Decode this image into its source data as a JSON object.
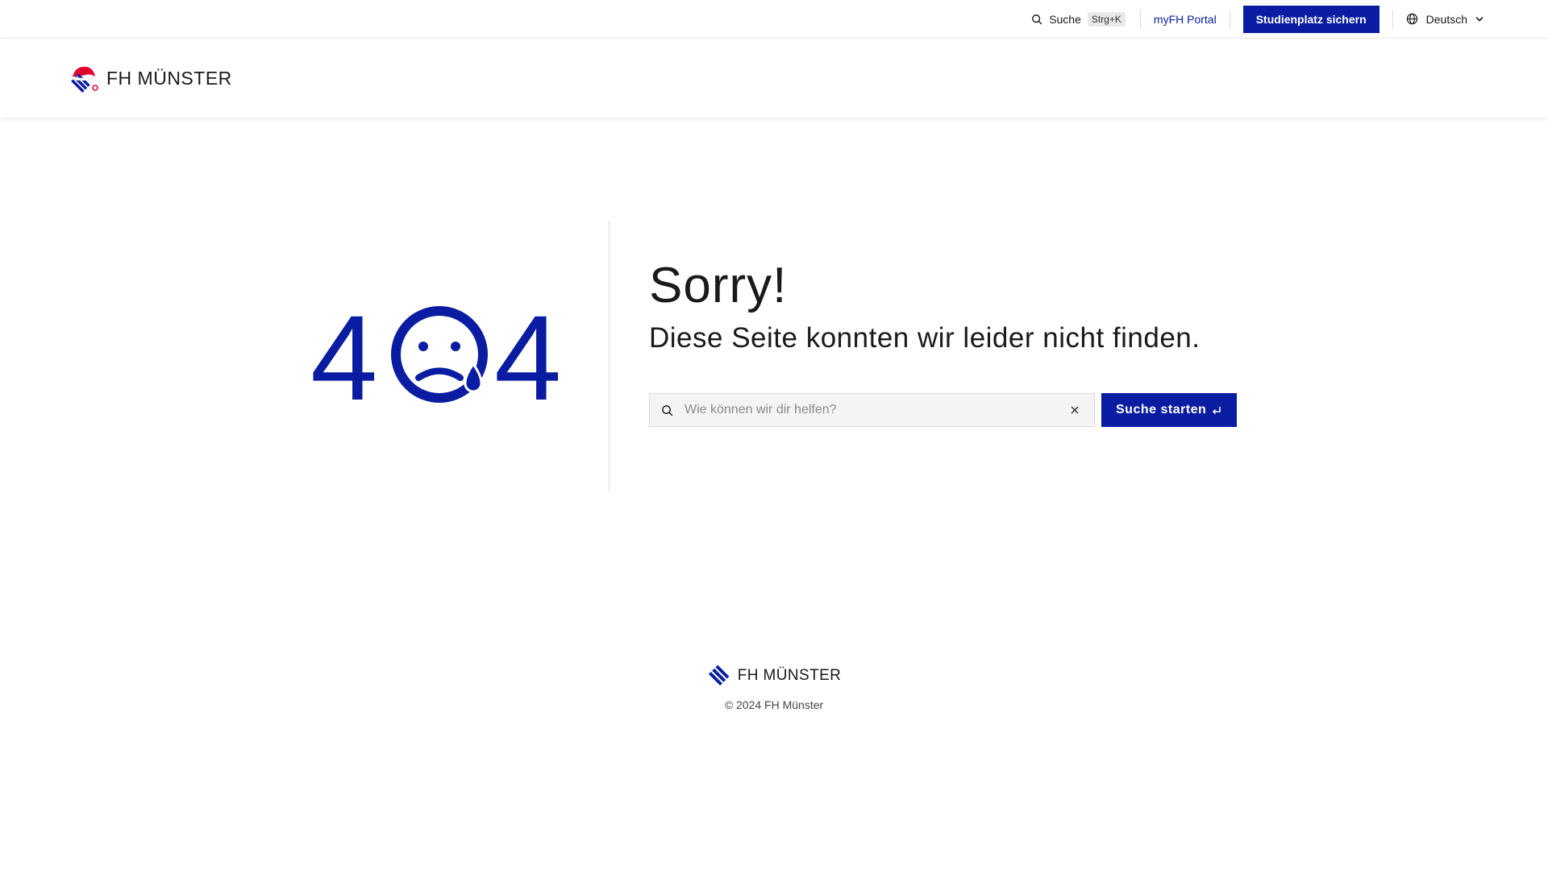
{
  "utility": {
    "search_label": "Suche",
    "search_shortcut": "Strg+K",
    "portal_link": "myFH Portal",
    "cta_label": "Studienplatz sichern",
    "language": "Deutsch"
  },
  "header": {
    "logo_text": "FH MÜNSTER"
  },
  "error": {
    "code_left": "4",
    "code_right": "4",
    "title": "Sorry!",
    "subtitle": "Diese Seite konnten wir leider nicht finden.",
    "search_placeholder": "Wie können wir dir helfen?",
    "search_value": "",
    "search_button": "Suche starten"
  },
  "footer": {
    "logo_text": "FH MÜNSTER",
    "copyright": "© 2024 FH Münster"
  },
  "colors": {
    "brand_blue": "#0a1da2",
    "brand_red": "#e3002d",
    "text": "#1a1a1a"
  },
  "icons": {
    "search": "search-icon",
    "globe": "globe-icon",
    "chevron": "chevron-down-icon",
    "clear": "close-icon",
    "enter": "enter-icon",
    "sad_face": "sad-face-icon"
  }
}
